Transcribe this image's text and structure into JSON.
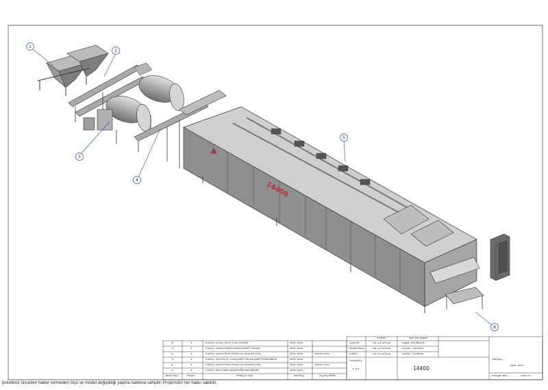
{
  "callouts": [
    "1",
    "2",
    "3",
    "4",
    "5",
    "6"
  ],
  "machine_marking": "14400",
  "parts_table": {
    "rows": [
      {
        "sira": "6",
        "adet": "1",
        "parca": "EVRO 1012-ACS TOZ ELEĞİ",
        "gerec": "AISI 304",
        "aciklama": ""
      },
      {
        "sira": "5",
        "adet": "1",
        "parca": "EVRO 14000-BRO KAVURMA FIRINI",
        "gerec": "AISI 304",
        "aciklama": ""
      },
      {
        "sira": "4",
        "adet": "2",
        "parca": "EVRO 5100-APE PALETLİ ELEVATÖR",
        "gerec": "AISI 304",
        "aciklama": "4000 mm"
      },
      {
        "sira": "3",
        "adet": "2",
        "parca": "EVRO 505-ATS TUZLAMA SOSLAMA MAKİNESİ",
        "gerec": "AISI 304",
        "aciklama": ""
      },
      {
        "sira": "2",
        "adet": "2",
        "parca": "EVRO 5100-APE PALETLİ ELEVATÖR",
        "gerec": "AISI 304",
        "aciklama": "3000 mm"
      },
      {
        "sira": "1",
        "adet": "2",
        "parca": "EVRO 400-ABS BESLEME BUNKERİ",
        "gerec": "AISI 304",
        "aciklama": ""
      }
    ],
    "headers": {
      "sira": "SIRA NO",
      "adet": "ADET",
      "parca": "PARÇA ADI",
      "gerec": "GEREÇ",
      "aciklama": "AÇIKLAMA"
    }
  },
  "title_block": {
    "col_tarih": "TARİH",
    "col_ad": "AD VE İMZA",
    "rows": [
      {
        "label": "ÇİZEN",
        "date": "01.11.2012",
        "name": "Uğur GÜNDÜZ"
      },
      {
        "label": "KONTROL",
        "date": "01.11.2012",
        "name": "Ömer YILMAZ"
      },
      {
        "label": "ONAY",
        "date": "01.11.2012",
        "name": "Ömer YILMAZ"
      }
    ],
    "olcek_label": "(ÖLÇEK)",
    "scale": "1:55",
    "drawing_title": "14400",
    "gerec_label": "GEREÇ :",
    "gerec_value": "AISI 304",
    "proje_label": "PROJE NO :",
    "proje_value": "144-07"
  },
  "footer_text": "Şirketimiz önceden haber vermeden ölçü ve model değişikliği yapma hakkına sahiptir. Projemizin her hakkı saklıdır."
}
